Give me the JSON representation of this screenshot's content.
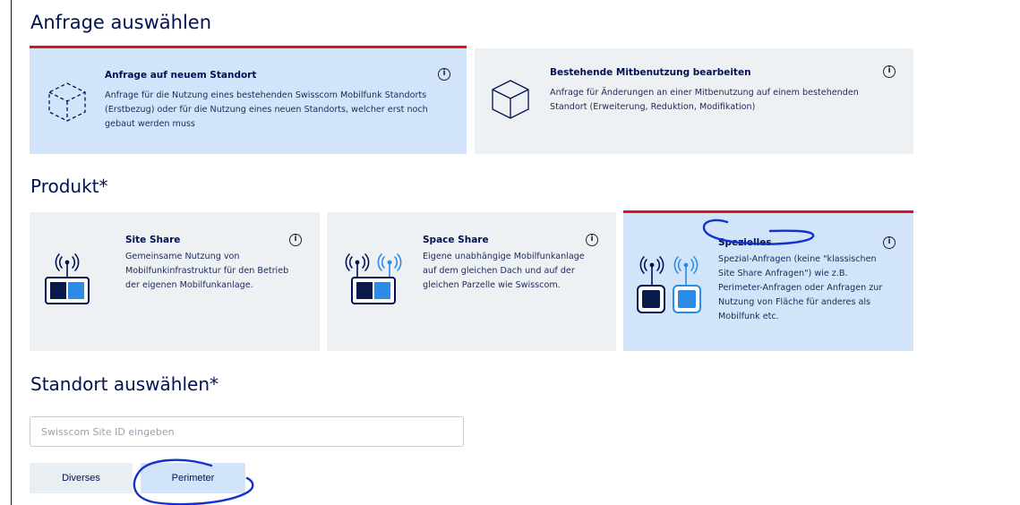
{
  "sections": {
    "anfrage_title": "Anfrage auswählen",
    "produkt_title": "Produkt*",
    "standort_title": "Standort auswählen*"
  },
  "anfrage_cards": [
    {
      "title": "Anfrage auf neuem Standort",
      "desc_lines": [
        "Anfrage für die Nutzung eines bestehenden Swisscom Mobilfunk Standorts",
        "(Erstbezug) oder für die Nutzung eines neuen Standorts, welcher erst noch",
        "gebaut werden muss"
      ],
      "icon": "dashed-cube-icon",
      "selected": true
    },
    {
      "title": "Bestehende Mitbenutzung bearbeiten",
      "desc_lines": [
        "Anfrage für Änderungen an einer Mitbenutzung auf einem bestehenden",
        "Standort (Erweiterung, Reduktion, Modifikation)"
      ],
      "icon": "cube-icon",
      "selected": false
    }
  ],
  "produkt_cards": [
    {
      "title": "Site Share",
      "desc_lines": [
        "Gemeinsame Nutzung von",
        "Mobilfunkinfrastruktur für den Betrieb",
        "der eigenen Mobilfunkanlage."
      ],
      "icon": "single-antenna-icon",
      "selected": false
    },
    {
      "title": "Space Share",
      "desc_lines": [
        "Eigene unabhängige Mobilfunkanlage",
        "auf dem gleichen Dach und auf der",
        "gleichen Parzelle wie Swisscom."
      ],
      "icon": "double-antenna-icon",
      "selected": false
    },
    {
      "title": "Spezielles",
      "desc_lines": [
        "Spezial-Anfragen (keine \"klassischen",
        "Site Share Anfragen\") wie z.B.",
        "Perimeter-Anfragen oder Anfragen zur",
        "Nutzung von Fläche für anderes als",
        "Mobilfunk etc."
      ],
      "icon": "separate-antennas-icon",
      "selected": true
    }
  ],
  "info_symbol": "i",
  "site_id_input": {
    "placeholder": "Swisscom Site ID eingeben",
    "value": ""
  },
  "buttons": {
    "diverses": "Diverses",
    "perimeter": "Perimeter"
  },
  "colors": {
    "navy": "#001155",
    "selected_bg": "#d2e4f9",
    "card_bg": "#eef1f3",
    "accent_red": "#dd1122",
    "annotation_blue": "#1133cc",
    "icon_blue": "#2b8be6"
  }
}
